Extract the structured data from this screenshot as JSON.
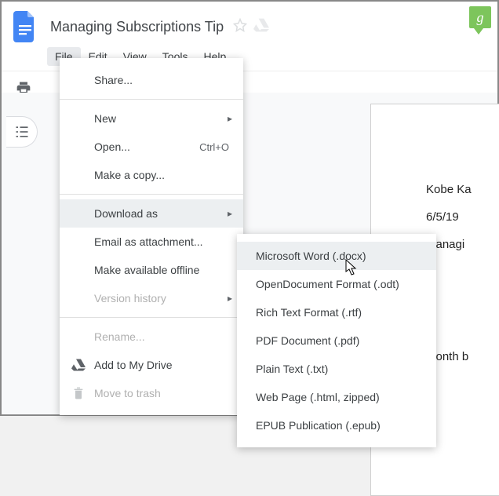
{
  "doc": {
    "title": "Managing Subscriptions Tip"
  },
  "menubar": [
    "File",
    "Edit",
    "View",
    "Tools",
    "Help"
  ],
  "file_menu": {
    "share": "Share...",
    "new": "New",
    "open": "Open...",
    "open_shortcut": "Ctrl+O",
    "make_copy": "Make a copy...",
    "download_as": "Download as",
    "email_attach": "Email as attachment...",
    "offline": "Make available offline",
    "version_history": "Version history",
    "rename": "Rename...",
    "add_drive": "Add to My Drive",
    "move_trash": "Move to trash"
  },
  "download_submenu": [
    "Microsoft Word (.docx)",
    "OpenDocument Format (.odt)",
    "Rich Text Format (.rtf)",
    "PDF Document (.pdf)",
    "Plain Text (.txt)",
    "Web Page (.html, zipped)",
    "EPUB Publication (.epub)"
  ],
  "page_content": {
    "author": "Kobe Ka",
    "date": "6/5/19",
    "subject": "Managi",
    "body": "month b"
  },
  "watermark": "g"
}
